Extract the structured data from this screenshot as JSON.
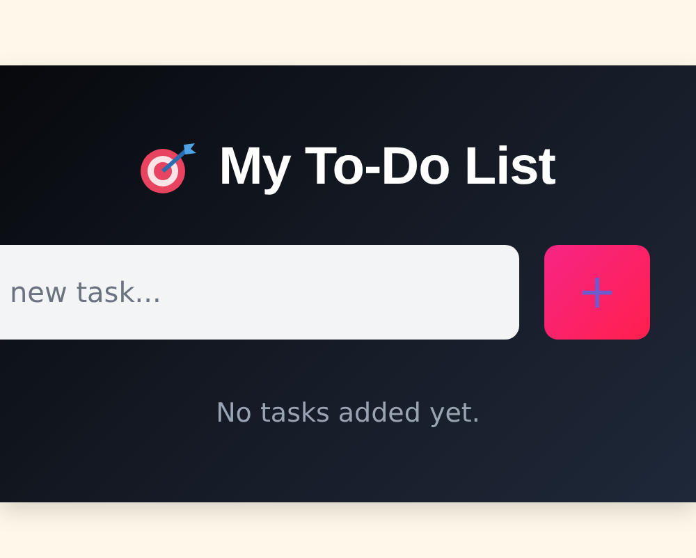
{
  "title": "My To-Do List",
  "task_input": {
    "placeholder": "new task..."
  },
  "add_button": {
    "label": "+"
  },
  "empty_message": "No tasks added yet."
}
